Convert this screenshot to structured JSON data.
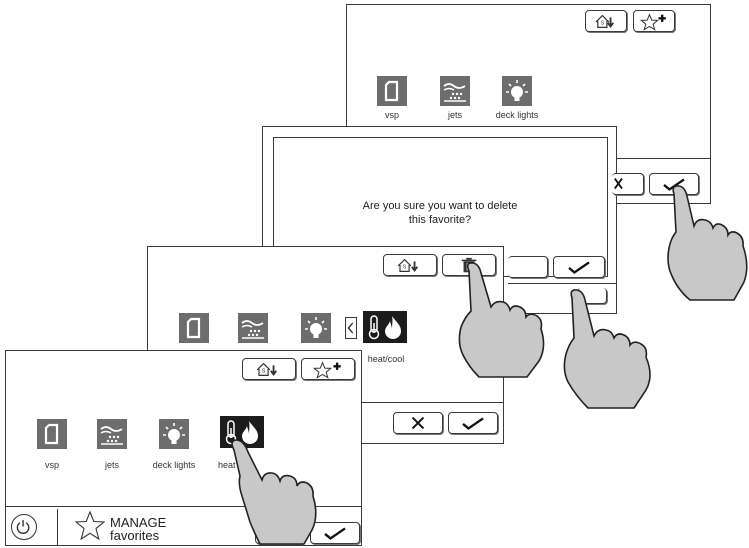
{
  "favorites": [
    {
      "label": "vsp",
      "icon": "vsp-pump-icon"
    },
    {
      "label": "jets",
      "icon": "jets-icon"
    },
    {
      "label": "deck lights",
      "icon": "deck-lights-icon"
    },
    {
      "label": "heat/cool",
      "icon": "heat-cool-icon"
    }
  ],
  "screen1_labels": {
    "vsp": "vsp",
    "jets": "jets",
    "deck": "deck lights",
    "heat": "heat"
  },
  "screen2_labels": {
    "heat": "heat/cool"
  },
  "screen4_labels": {
    "vsp": "vsp",
    "jets": "jets",
    "deck": "deck lights"
  },
  "dialog": {
    "line1": "Are you sure you want to delete",
    "line2": "this favorite?"
  },
  "nav": {
    "title_line1": "MANAGE",
    "title_line2": "favorites"
  },
  "icons": {
    "home_edit": "home-sort-icon",
    "add_favorite": "star-plus-icon",
    "delete": "trash-icon",
    "cancel": "x-icon",
    "confirm": "checkmark-icon",
    "power": "power-icon",
    "star": "star-outline-icon",
    "chevron": "chevron-left-icon",
    "hand": "pointing-hand-icon"
  },
  "colors": {
    "tile_gray": "#6d6d6d",
    "tile_dark": "#1c1c1c",
    "hand_fill": "#c8c8c8",
    "outline": "#3a3a3a"
  }
}
